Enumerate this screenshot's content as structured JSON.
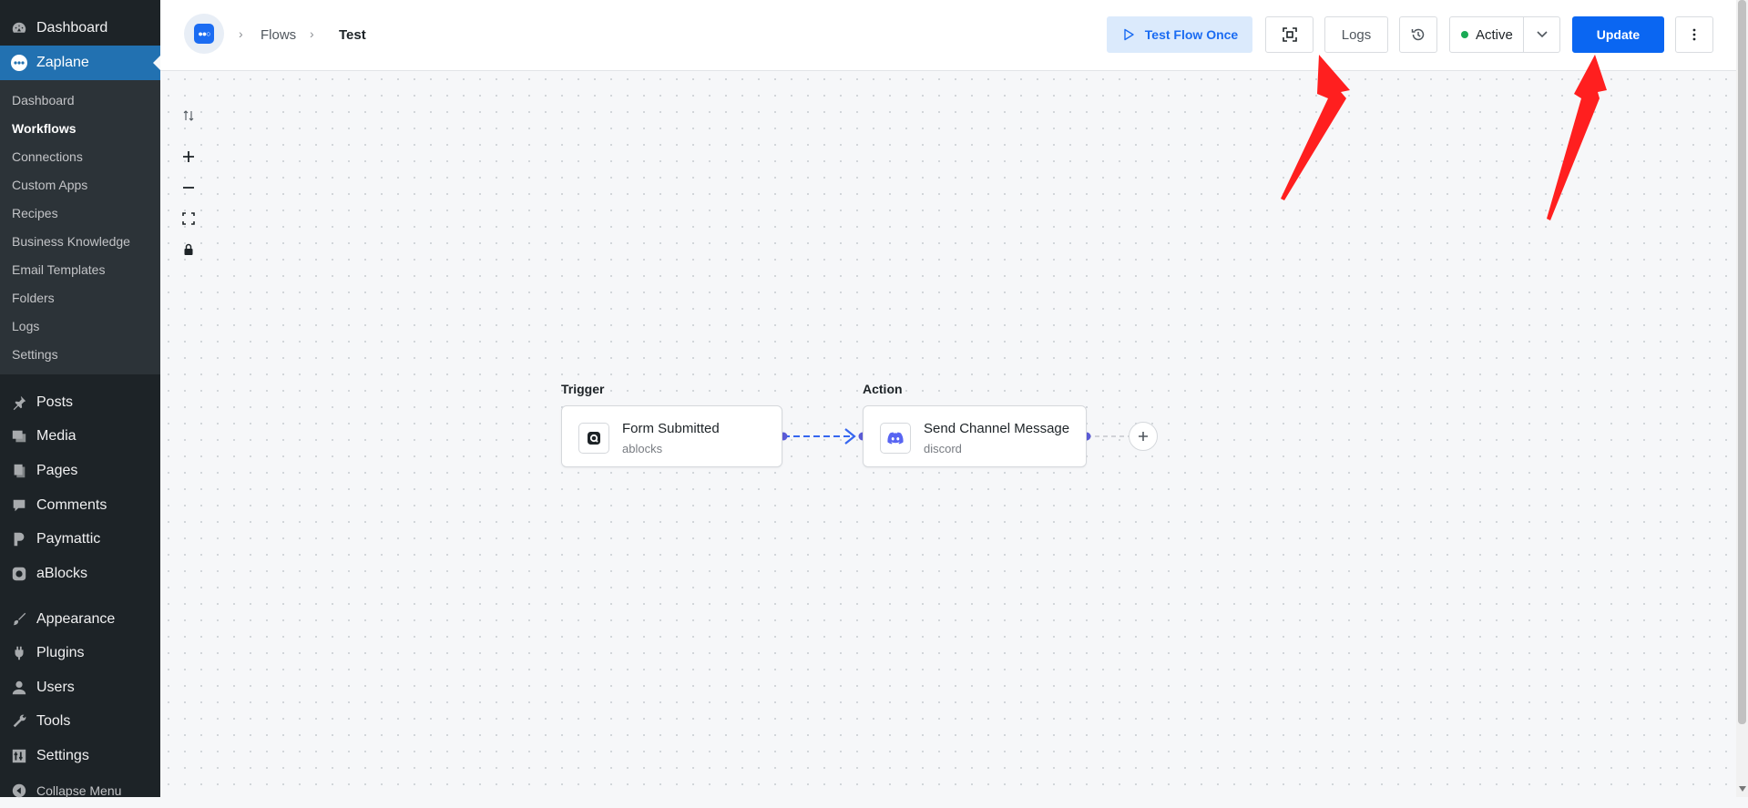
{
  "sidebar": {
    "dashboard": "Dashboard",
    "zaplane": "Zaplane",
    "submenu": [
      "Dashboard",
      "Workflows",
      "Connections",
      "Custom Apps",
      "Recipes",
      "Business Knowledge",
      "Email Templates",
      "Folders",
      "Logs",
      "Settings"
    ],
    "menu": [
      "Posts",
      "Media",
      "Pages",
      "Comments",
      "Paymattic",
      "aBlocks",
      "Appearance",
      "Plugins",
      "Users",
      "Tools",
      "Settings",
      "Collapse Menu"
    ]
  },
  "header": {
    "breadcrumb": {
      "flows": "Flows",
      "current": "Test"
    },
    "test_flow_label": "Test Flow Once",
    "logs_label": "Logs",
    "status_label": "Active",
    "update_label": "Update"
  },
  "flow": {
    "trigger": {
      "section": "Trigger",
      "title": "Form Submitted",
      "app": "ablocks"
    },
    "action": {
      "section": "Action",
      "title": "Send Channel Message",
      "app": "discord"
    }
  },
  "colors": {
    "sidebar_bg": "#1d2327",
    "wp_blue": "#2271b1",
    "primary_button": "#0a66f2",
    "status_green": "#1aaa55",
    "annotation_red": "#ff1f1f",
    "connector": "#5b5bd6"
  }
}
